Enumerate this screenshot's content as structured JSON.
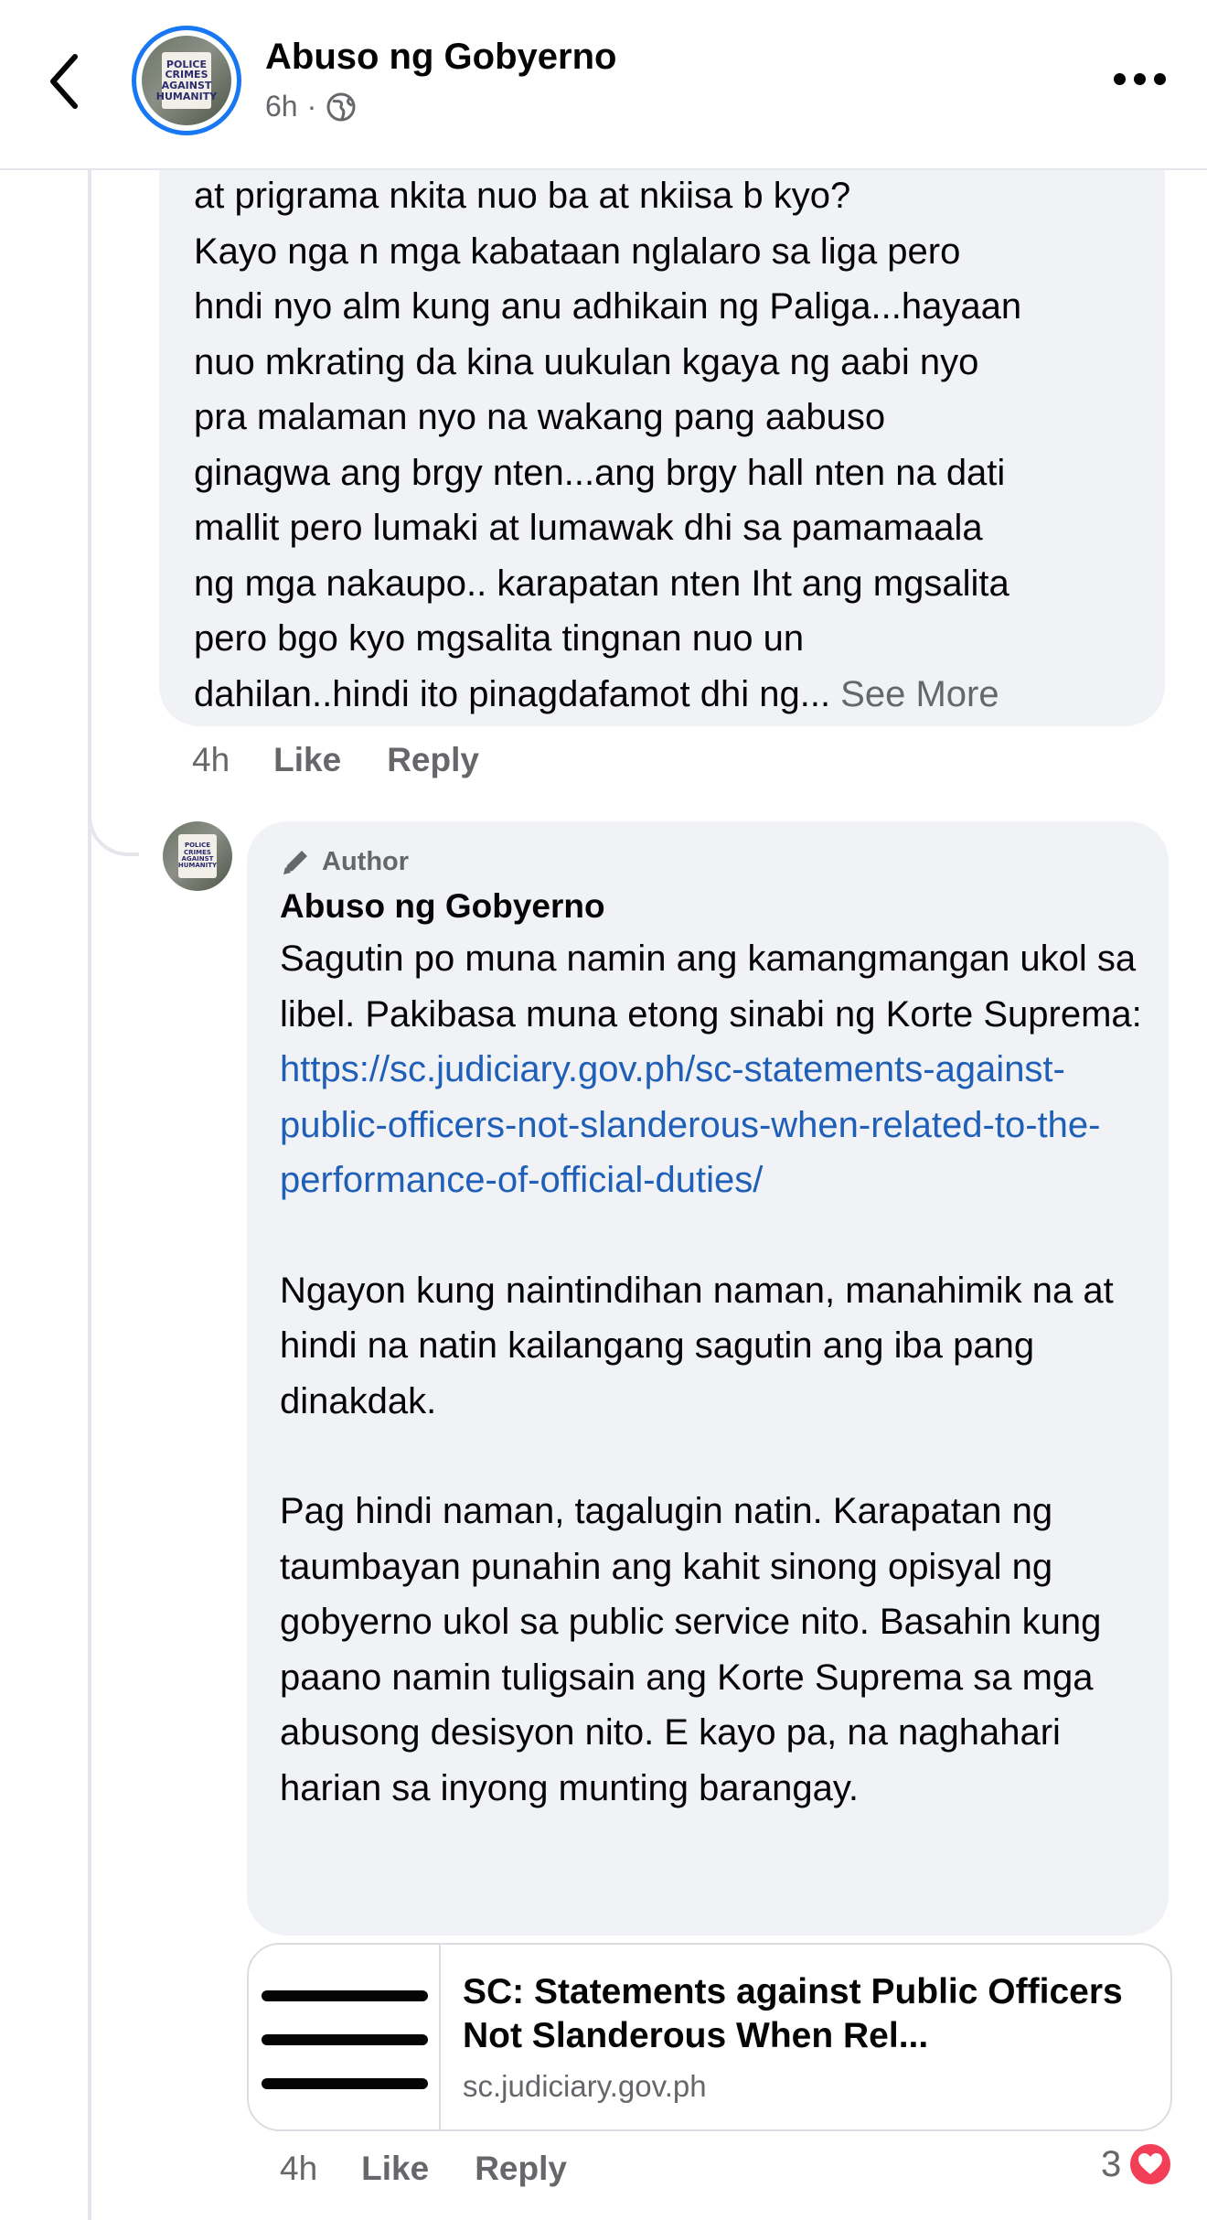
{
  "header": {
    "title": "Abuso ng Gobyerno",
    "time": "6h",
    "separator": "·",
    "audience_icon": "globe-icon"
  },
  "avatar_sign": [
    "POLICE",
    "CRIMES",
    "AGAINST",
    "HUMANITY"
  ],
  "comment": {
    "text": "at prigrama nkita nuo ba at nkiisa b kyo?\nKayo nga n mga kabataan nglalaro sa liga pero\nhndi nyo alm kung anu adhikain ng Paliga...hayaan\nnuo mkrating da kina uukulan kgaya ng aabi nyo\npra malaman nyo na wakang pang aabuso\nginagwa ang brgy nten...ang brgy hall nten na dati\nmallit pero lumaki at lumawak dhi sa pamamaala\nng mga nakaupo.. karapatan nten Iht ang mgsalita\npero bgo kyo mgsalita tingnan nuo un\ndahilan..hindi ito pinagdafamot dhi ng... ",
    "see_more": "See More",
    "time": "4h",
    "like": "Like",
    "reply": "Reply"
  },
  "reply": {
    "badge": "Author",
    "author": "Abuso ng Gobyerno",
    "p1_before_link": "Sagutin po muna namin ang kamangmangan ukol sa libel. Pakibasa muna etong sinabi ng Korte Suprema: ",
    "link_text": "https://sc.judiciary.gov.ph/sc-statements-against-public-officers-not-slanderous-when-related-to-the-performance-of-official-duties/",
    "p2": "Ngayon kung naintindihan naman, manahimik na at hindi na natin kailangang sagutin ang iba pang dinakdak.",
    "p3": "Pag hindi naman, tagalugin natin. Karapatan ng taumbayan punahin ang kahit sinong opisyal ng gobyerno ukol sa public service nito. Basahin kung paano namin tuligsain ang Korte Suprema sa mga abusong desisyon nito. E kayo pa, na naghahari harian sa inyong munting barangay.",
    "link_preview": {
      "title": "SC: Statements against Public Officers Not Slanderous When Rel...",
      "domain": "sc.judiciary.gov.ph"
    },
    "time": "4h",
    "like": "Like",
    "reply": "Reply",
    "reaction_count": "3",
    "reaction_icon": "heart-icon"
  },
  "colors": {
    "accent": "#1877f2",
    "link": "#1f5fb8",
    "bubble": "#f0f2f5",
    "secondary_text": "#65676b",
    "heart": "#f33e58"
  }
}
